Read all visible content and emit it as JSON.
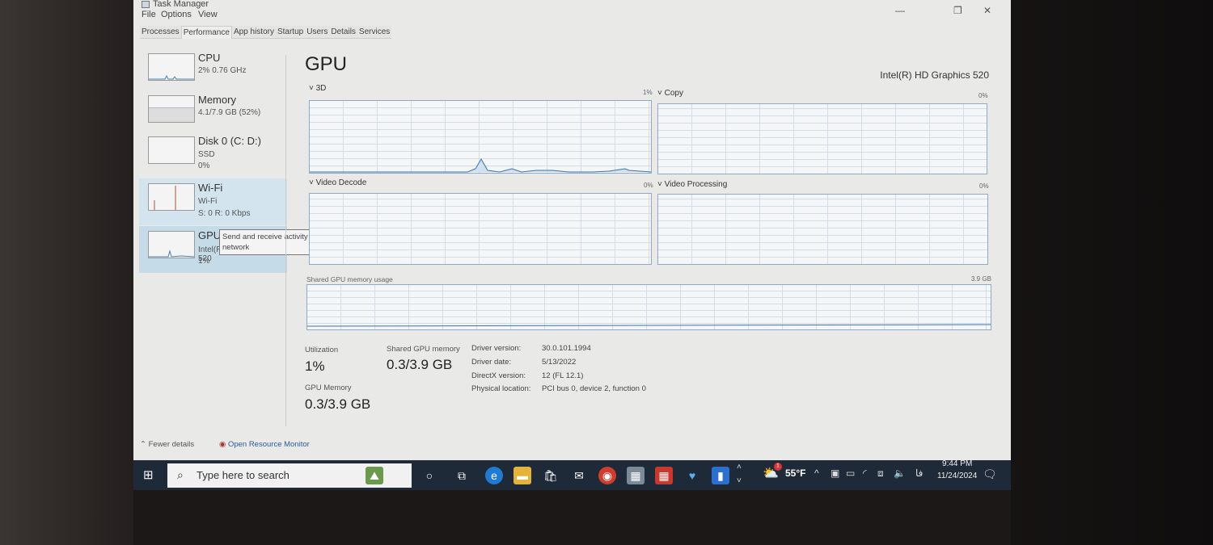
{
  "window": {
    "title": "Task Manager",
    "menu": [
      "File",
      "Options",
      "View"
    ],
    "tabs": [
      "Processes",
      "Performance",
      "App history",
      "Startup",
      "Users",
      "Details",
      "Services"
    ],
    "active_tab": "Performance"
  },
  "sidebar": {
    "items": [
      {
        "title": "CPU",
        "line1": "2% 0.76 GHz"
      },
      {
        "title": "Memory",
        "line1": "4.1/7.9 GB (52%)"
      },
      {
        "title": "Disk 0 (C: D:)",
        "line1": "SSD",
        "line2": "0%"
      },
      {
        "title": "Wi-Fi",
        "line1": "Wi-Fi",
        "line2": "S: 0 R: 0 Kbps"
      },
      {
        "title": "GPU",
        "line1": "Intel(R) HD Graphics 520",
        "line2": "1%"
      }
    ],
    "tooltip": "Send and receive activity on this network"
  },
  "main": {
    "heading": "GPU",
    "device": "Intel(R) HD Graphics 520",
    "graphs": [
      {
        "label": "3D",
        "pct": "1%"
      },
      {
        "label": "Copy",
        "pct": "0%"
      },
      {
        "label": "Video Decode",
        "pct": "0%"
      },
      {
        "label": "Video Processing",
        "pct": "0%"
      }
    ],
    "shared_label": "Shared GPU memory usage",
    "shared_max": "3.9 GB",
    "stats": {
      "utilization_label": "Utilization",
      "utilization": "1%",
      "shared_label": "Shared GPU memory",
      "shared": "0.3/3.9 GB",
      "gpumem_label": "GPU Memory",
      "gpumem": "0.3/3.9 GB"
    },
    "details": [
      {
        "k": "Driver version:",
        "v": "30.0.101.1994"
      },
      {
        "k": "Driver date:",
        "v": "5/13/2022"
      },
      {
        "k": "DirectX version:",
        "v": "12 (FL 12.1)"
      },
      {
        "k": "Physical location:",
        "v": "PCI bus 0, device 2, function 0"
      }
    ]
  },
  "footer": {
    "fewer": "Fewer details",
    "monitor": "Open Resource Monitor"
  },
  "taskbar": {
    "search_placeholder": "Type here to search",
    "weather": "55°F",
    "weather_badge": "1",
    "time": "9:44 PM",
    "date": "11/24/2024",
    "lang": "فا"
  }
}
